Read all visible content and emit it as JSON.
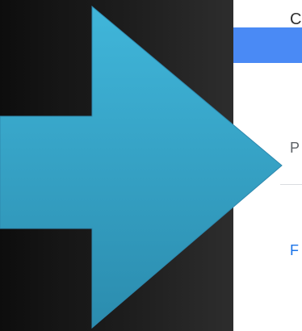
{
  "dialog": {
    "title_fragment": "C",
    "field_label": "P",
    "link_text": "F"
  },
  "colors": {
    "header_blue": "#4a8af5",
    "arrow_teal": "#3da5cf",
    "link_blue": "#1a73e8",
    "background_dark": "#1a1a1a"
  },
  "icons": {
    "overlay": "right-arrow-icon"
  }
}
